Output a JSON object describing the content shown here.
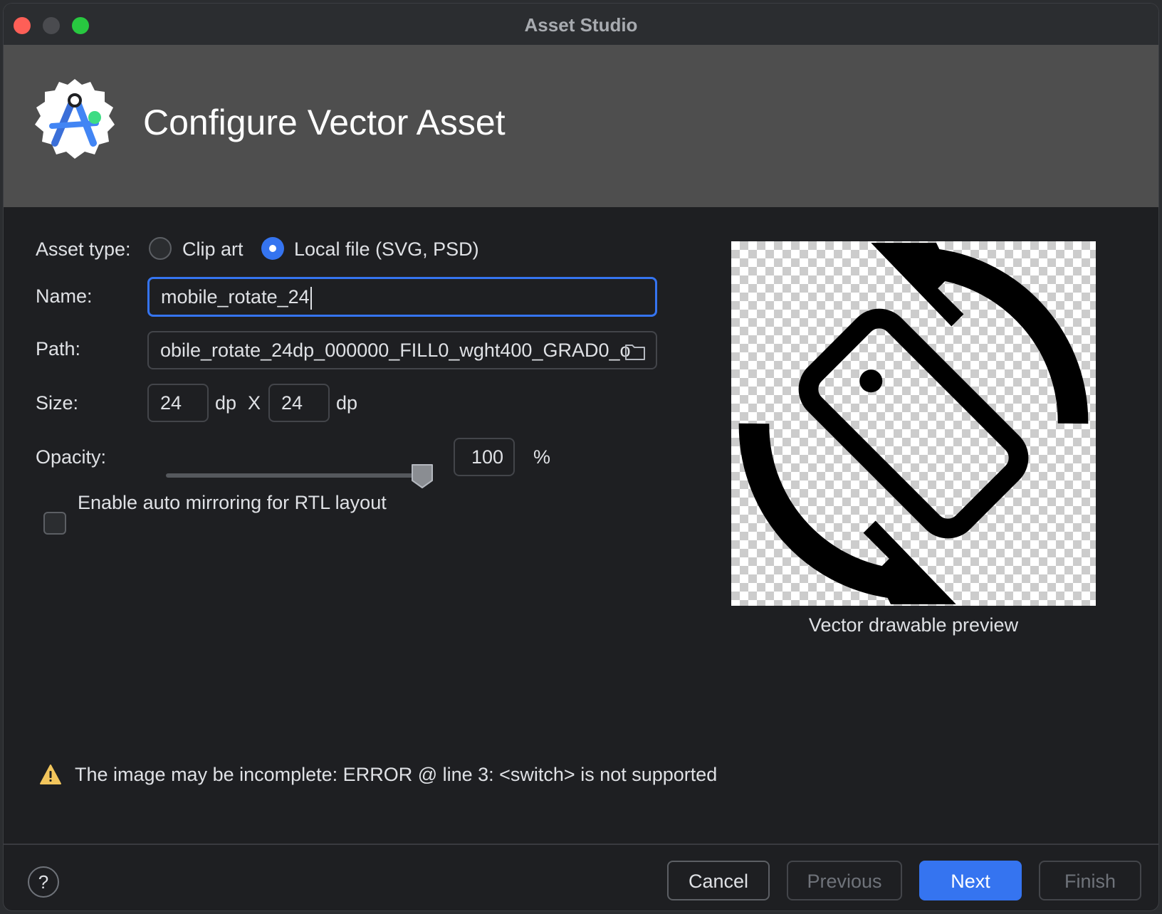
{
  "window": {
    "title": "Asset Studio"
  },
  "header": {
    "title": "Configure Vector Asset",
    "logo_icon": "android-studio-logo-icon"
  },
  "form": {
    "asset_type": {
      "label": "Asset type:",
      "options": [
        {
          "label": "Clip art",
          "selected": false
        },
        {
          "label": "Local file (SVG, PSD)",
          "selected": true
        }
      ]
    },
    "name": {
      "label": "Name:",
      "value": "mobile_rotate_24"
    },
    "path": {
      "label": "Path:",
      "value": "obile_rotate_24dp_000000_FILL0_wght400_GRAD0_o",
      "icon": "folder-icon"
    },
    "size": {
      "label": "Size:",
      "width": "24",
      "height": "24",
      "unit": "dp",
      "separator": "X"
    },
    "opacity": {
      "label": "Opacity:",
      "value": "100",
      "unit": "%",
      "slider_fraction": 1.0
    },
    "auto_mirror": {
      "label": "Enable auto mirroring for RTL layout",
      "checked": false
    }
  },
  "preview": {
    "caption": "Vector drawable preview",
    "icon": "mobile-rotate-icon"
  },
  "warning": {
    "icon": "warning-icon",
    "text": "The image may be incomplete: ERROR @ line 3: <switch> is not supported"
  },
  "footer": {
    "help": "?",
    "cancel": "Cancel",
    "previous": "Previous",
    "next": "Next",
    "finish": "Finish"
  },
  "colors": {
    "accent": "#3574f0",
    "warning": "#f2c55c",
    "banner": "#4e4e4e"
  }
}
